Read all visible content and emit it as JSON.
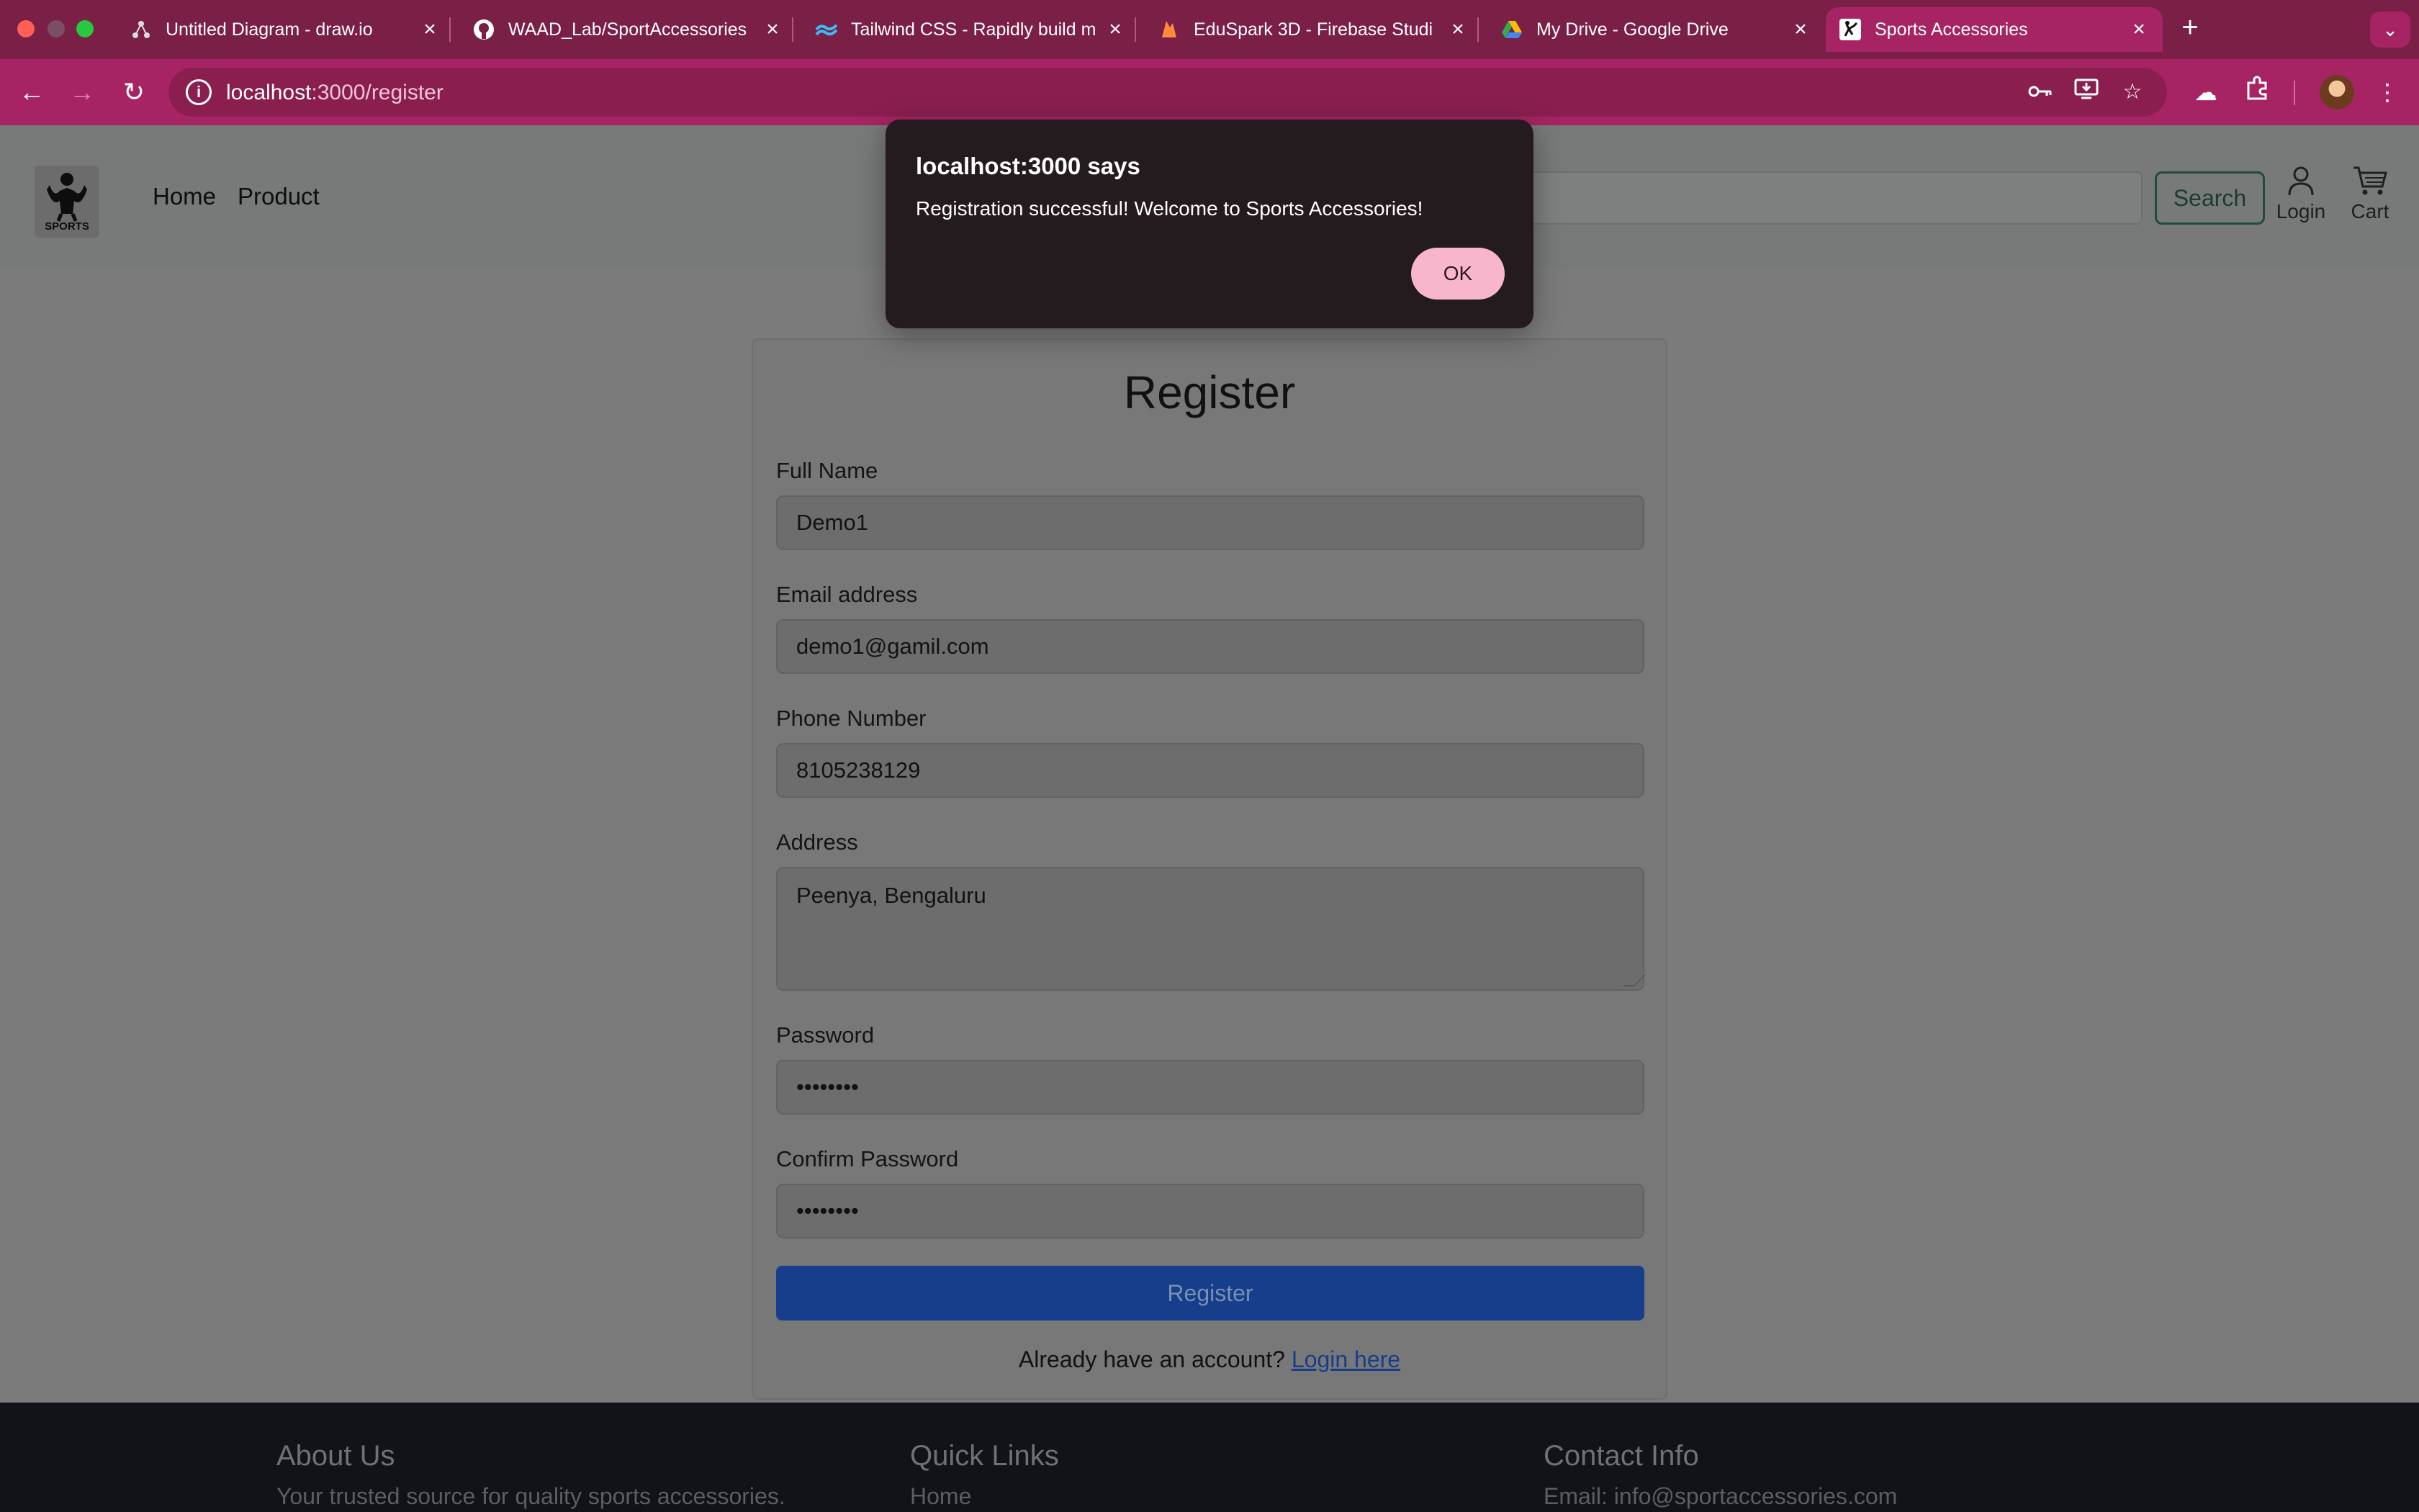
{
  "browser": {
    "tabs": [
      {
        "title": "Untitled Diagram - draw.io",
        "favicon": "drawio-icon"
      },
      {
        "title": "WAAD_Lab/SportAccessories",
        "favicon": "github-icon"
      },
      {
        "title": "Tailwind CSS - Rapidly build m",
        "favicon": "tailwind-icon"
      },
      {
        "title": "EduSpark 3D - Firebase Studi",
        "favicon": "firebase-icon"
      },
      {
        "title": "My Drive - Google Drive",
        "favicon": "google-drive-icon"
      },
      {
        "title": "Sports Accessories",
        "favicon": "site-icon",
        "active": true
      }
    ],
    "url_host": "localhost",
    "url_path": ":3000/register"
  },
  "site": {
    "nav": [
      "Home",
      "Product"
    ],
    "search_label": "Search",
    "login_label": "Login",
    "cart_label": "Cart",
    "logo_text": "SPORTS"
  },
  "form": {
    "title": "Register",
    "fields": [
      {
        "label": "Full Name",
        "value": "Demo1"
      },
      {
        "label": "Email address",
        "value": "demo1@gamil.com"
      },
      {
        "label": "Phone Number",
        "value": "8105238129"
      },
      {
        "label": "Address",
        "value": "Peenya, Bengaluru"
      },
      {
        "label": "Password",
        "value": "••••••••"
      },
      {
        "label": "Confirm Password",
        "value": "••••••••"
      }
    ],
    "submit_label": "Register",
    "already_text": "Already have an account?",
    "login_link": "Login here"
  },
  "footer": {
    "about_title": "About Us",
    "about_text": "Your trusted source for quality sports accessories.",
    "links_title": "Quick Links",
    "links_first": "Home",
    "contact_title": "Contact Info",
    "contact_email": "Email: info@sportaccessories.com"
  },
  "dialog": {
    "title": "localhost:3000 says",
    "message": "Registration successful! Welcome to Sports Accessories!",
    "ok_label": "OK"
  },
  "colors": {
    "tabbar": "#7a1f45",
    "toolbar": "#a62463",
    "dialog_bg": "#241b1f",
    "ok_button": "#f7b6cc",
    "submit_button": "#163e8a"
  }
}
